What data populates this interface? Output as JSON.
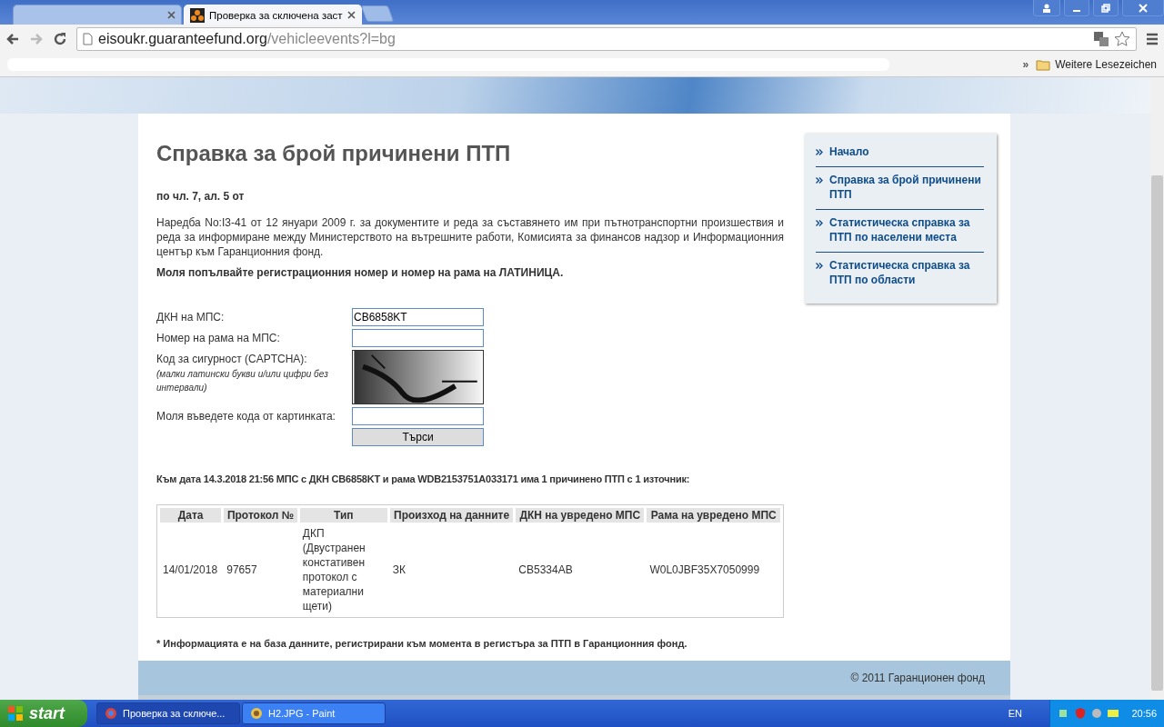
{
  "browser": {
    "tabs": [
      {
        "selected": false
      },
      {
        "title": "Проверка за сключена заст",
        "selected": true
      }
    ],
    "address": {
      "host": "eisoukr.guaranteefund.org",
      "path": "/vehicleevents?l=bg"
    },
    "bookmarks": {
      "more": "»",
      "folder": "Weitere Lesezeichen"
    }
  },
  "page": {
    "title": "Справка за брой причинени ПТП",
    "subtitle": "по чл. 7, ал. 5 от",
    "intro": "Наредба No:I3-41 от 12 януари 2009 г. за документите и реда за съставянето им при пътнотранспортни произшествия и реда за информиране между Министерството на вътрешните работи, Комисията за финансов надзор и Информационния център към Гаранционния фонд.",
    "notice": "Моля попълвайте регистрационния номер и номер на рама на ЛАТИНИЦА.",
    "form": {
      "fields": [
        {
          "kind": "input",
          "label": "ДКН на МПС:",
          "value": "CB6858KT"
        },
        {
          "kind": "input",
          "label": "Номер на рама на МПС:"
        },
        {
          "kind": "captcha",
          "label": "Код за сигурност (CAPTCHA):",
          "hint": "(малки латински букви и/или цифри без интервали)"
        },
        {
          "kind": "input",
          "label": "Моля въведете кода от картинката:"
        }
      ],
      "button": "Търси"
    },
    "result": "Към дата 14.3.2018 21:56 МПС с ДКН CB6858KT и рама WDB2153751A033171 има 1 причинено ПТП с 1 източник:",
    "table": {
      "columns": [
        "Дата",
        "Протокол №",
        "Тип",
        "Произход на данните",
        "ДКН на увредено МПС",
        "Рама на увредено МПС"
      ],
      "rows": [
        [
          "14/01/2018",
          "97657",
          "ДКП (Двустранен констативен протокол с материални щети)",
          "ЗК",
          "CB5334AB",
          "W0L0JBF35X7050999"
        ]
      ]
    },
    "footnote": "* Информацията е на база данните, регистрирани към момента в регистъра за ПТП в Гаранционния фонд.",
    "sidebar": {
      "items": [
        {
          "label": "Начало"
        },
        {
          "label": "Справка за брой причинени ПТП"
        },
        {
          "label": "Статистическа справка за ПТП по населени места"
        },
        {
          "label": "Статистическа справка за ПТП по области"
        }
      ]
    },
    "footer": "© 2011 Гаранционен фонд"
  },
  "taskbar": {
    "start": "start",
    "tasks": [
      {
        "label": "Проверка за сключе...",
        "selected": true
      },
      {
        "label": "H2.JPG - Paint",
        "selected": false
      }
    ],
    "language": "EN",
    "clock": "20:56"
  }
}
